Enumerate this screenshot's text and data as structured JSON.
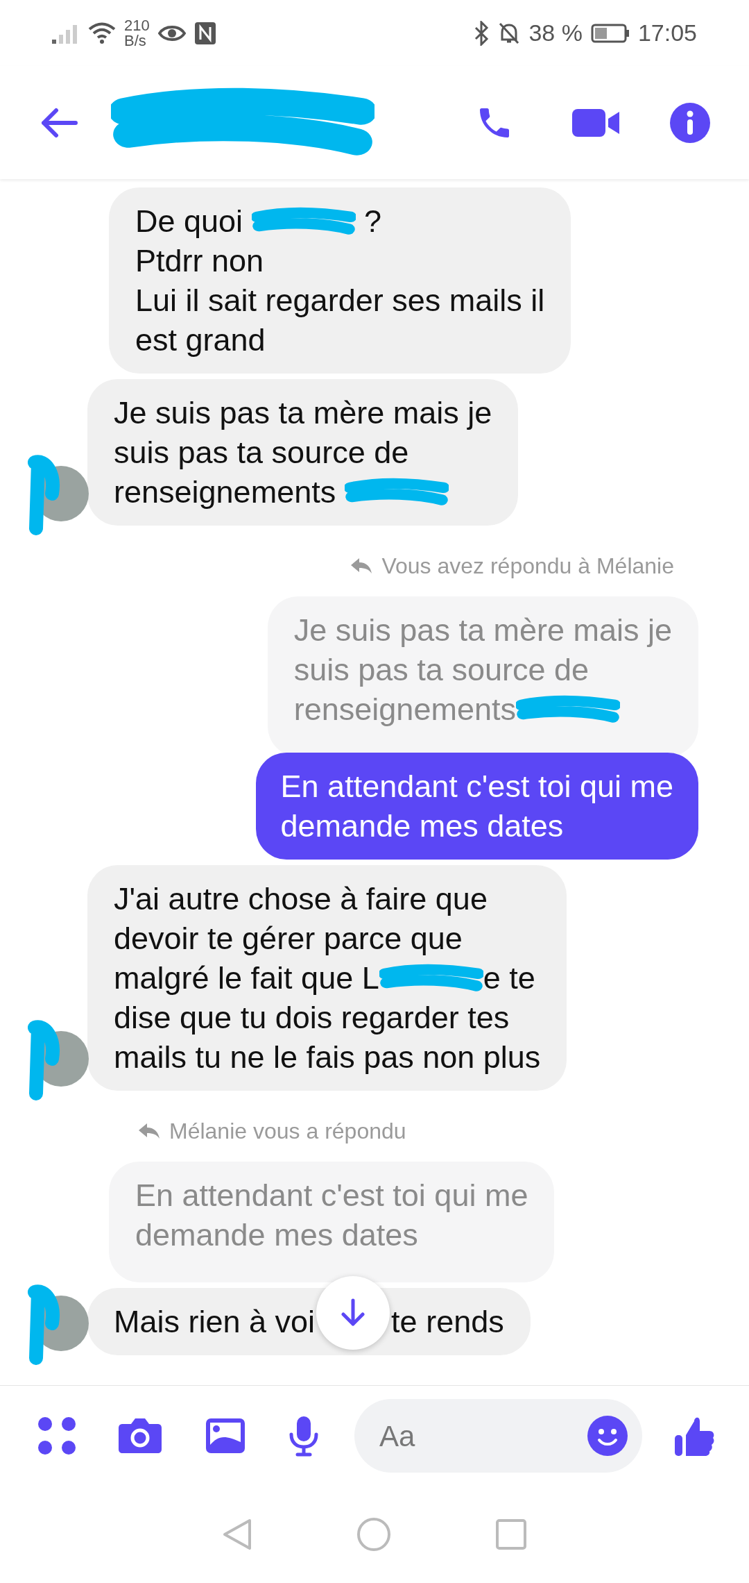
{
  "status_bar": {
    "network_speed": [
      "210",
      "B/s"
    ],
    "battery": "38 %",
    "time": "17:05"
  },
  "messages": [
    {
      "kind": "incoming",
      "avatar": false,
      "lines": [
        [
          {
            "text": "De quoi "
          },
          {
            "kind": "redacted"
          },
          {
            "text": " ?"
          }
        ],
        [
          {
            "text": "Ptdrr non"
          }
        ],
        [
          {
            "text": "Lui il sait regarder ses mails il"
          }
        ],
        [
          {
            "text": "est grand"
          }
        ]
      ]
    },
    {
      "kind": "incoming",
      "avatar": true,
      "lines": [
        [
          {
            "text": "Je suis pas ta mère mais je"
          }
        ],
        [
          {
            "text": "suis pas ta source de"
          }
        ],
        [
          {
            "text": "renseignements "
          },
          {
            "kind": "redacted"
          }
        ]
      ]
    },
    {
      "kind": "my_reply_note",
      "text": "Vous avez répondu à Mélanie"
    },
    {
      "kind": "my_quote",
      "lines": [
        [
          {
            "text": "Je suis pas ta mère mais je"
          }
        ],
        [
          {
            "text": "suis pas ta source de"
          }
        ],
        [
          {
            "text": "renseignements"
          },
          {
            "kind": "redacted"
          }
        ]
      ]
    },
    {
      "kind": "outgoing",
      "lines": [
        [
          {
            "text": "En attendant c'est toi qui me"
          }
        ],
        [
          {
            "text": "demande mes dates"
          }
        ]
      ]
    },
    {
      "kind": "incoming",
      "avatar": true,
      "lines": [
        [
          {
            "text": "J'ai autre chose à faire que"
          }
        ],
        [
          {
            "text": "devoir te gérer parce que"
          }
        ],
        [
          {
            "text": "malgré le fait que L"
          },
          {
            "kind": "redacted"
          },
          {
            "text": "e te"
          }
        ],
        [
          {
            "text": "dise que tu dois regarder tes"
          }
        ],
        [
          {
            "text": "mails tu ne le fais pas non plus"
          }
        ]
      ]
    },
    {
      "kind": "their_reply_note",
      "text": "Mélanie vous a répondu"
    },
    {
      "kind": "their_quote",
      "lines": [
        [
          {
            "text": "En attendant c'est toi qui me"
          }
        ],
        [
          {
            "text": "demande mes dates"
          }
        ]
      ]
    },
    {
      "kind": "incoming",
      "avatar": true,
      "lines": [
        [
          {
            "text": "Mais rien à voi"
          },
          {
            "kind": "covered"
          },
          {
            "text": "te rends"
          }
        ]
      ]
    }
  ],
  "composer": {
    "placeholder": "Aa"
  }
}
